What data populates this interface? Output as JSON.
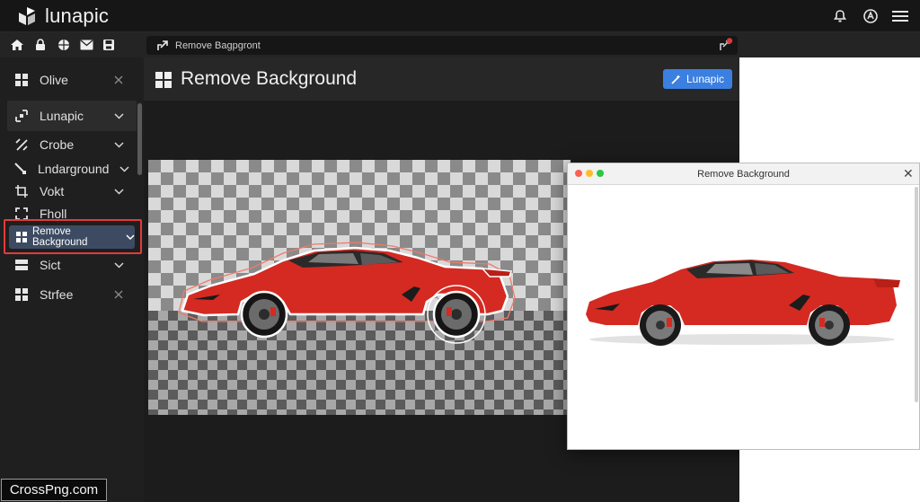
{
  "app": {
    "name": "lunapic"
  },
  "tab": {
    "title": "Remove Bagpgront"
  },
  "sidebar": {
    "items": [
      {
        "label": "Olive"
      },
      {
        "label": "Lunapic"
      },
      {
        "label": "Crobe"
      },
      {
        "label": "Lndarground"
      },
      {
        "label": "Vokt"
      },
      {
        "label": "Fholl"
      },
      {
        "label": "Remove Background"
      },
      {
        "label": "Sict"
      },
      {
        "label": "Strfee"
      }
    ]
  },
  "main": {
    "title": "Remove Background",
    "button_label": "Lunapic"
  },
  "preview": {
    "title": "Remove Background"
  },
  "watermark": "CrossPng.com",
  "colors": {
    "accent": "#3b7fe0",
    "highlight": "#e23b3b",
    "car": "#d42a22"
  }
}
